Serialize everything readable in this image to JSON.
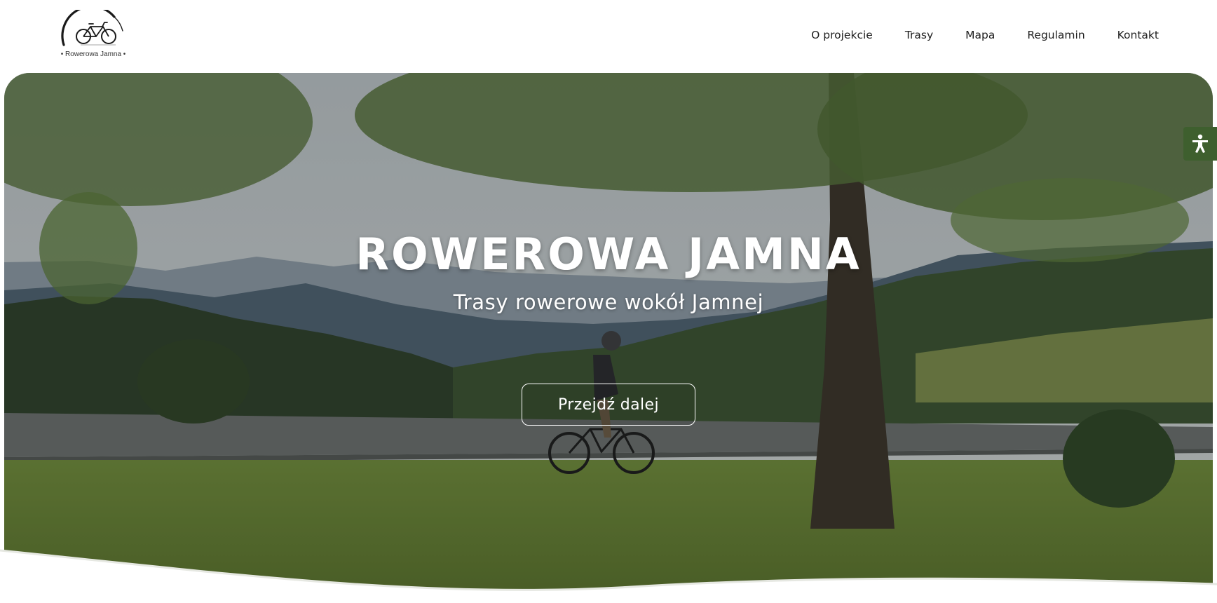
{
  "brand": {
    "logo_text": "• Rowerowa Jamna •",
    "icon": "bicycle-logo-icon"
  },
  "nav": {
    "items": [
      {
        "label": "O projekcie"
      },
      {
        "label": "Trasy"
      },
      {
        "label": "Mapa"
      },
      {
        "label": "Regulamin"
      },
      {
        "label": "Kontakt"
      }
    ]
  },
  "hero": {
    "title": "ROWEROWA JAMNA",
    "subtitle": "Trasy rowerowe wokół Jamnej",
    "cta_label": "Przejdź dalej",
    "image": "cyclist-landscape-photo"
  },
  "accessibility": {
    "icon": "accessibility-person-icon",
    "color": "#3e5f2e"
  },
  "colors": {
    "text": "#1f1f1f",
    "hero_text": "#ffffff",
    "accent_green": "#3e5f2e"
  }
}
